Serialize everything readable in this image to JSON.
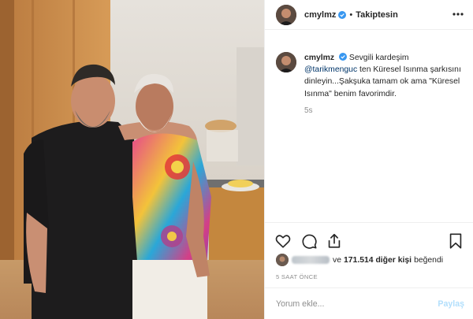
{
  "colors": {
    "text": "#262626",
    "muted": "#8e8e8e",
    "link": "#003569",
    "verified": "#3897f0",
    "post_button_disabled": "#b2dffc",
    "border": "#efefef"
  },
  "header": {
    "username": "cmylmz",
    "separator": "•",
    "follow_status": "Takiptesin",
    "verified_icon": "verified-badge-icon",
    "more_icon": "more-options-icon"
  },
  "caption": {
    "username": "cmylmz",
    "text_before_mention": "Sevgili kardeşim",
    "mention": "@tarikmenguc",
    "text_after_mention": "ten Küresel Isınma şarkısını dinleyin...Şakşuka tamam ok ama \"Küresel Isınma\" benim favorimdir.",
    "time": "5s"
  },
  "actions": {
    "like_icon": "heart-icon",
    "comment_icon": "comment-icon",
    "share_icon": "share-icon",
    "save_icon": "bookmark-icon"
  },
  "likes": {
    "prefix": "ve",
    "count": "171.514",
    "others": "diğer kişi",
    "suffix": "beğendi"
  },
  "post_date": "5 SAAT ÖNCE",
  "comment": {
    "placeholder": "Yorum ekle...",
    "value": "",
    "post_label": "Paylaş"
  }
}
